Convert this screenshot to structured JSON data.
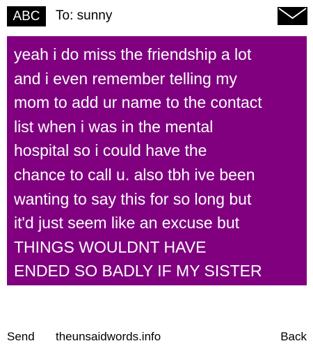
{
  "header": {
    "badge_label": "ABC",
    "to_label": "To: sunny",
    "icon": "envelope-icon"
  },
  "message": {
    "text": "yeah i do miss the friendship a lot\nand i even remember telling my\nmom to add ur name to the contact\nlist when i was in the mental\nhospital so i could have the\nchance to call u. also tbh ive been\nwanting to say this for so long but\nit'd just seem like an excuse but\nTHINGS WOULDNT HAVE\nENDED SO BADLY IF MY SISTER",
    "background_color": "#800080",
    "text_color": "#ffffff"
  },
  "footer": {
    "send_label": "Send",
    "site_label": "theunsaidwords.info",
    "back_label": "Back"
  }
}
